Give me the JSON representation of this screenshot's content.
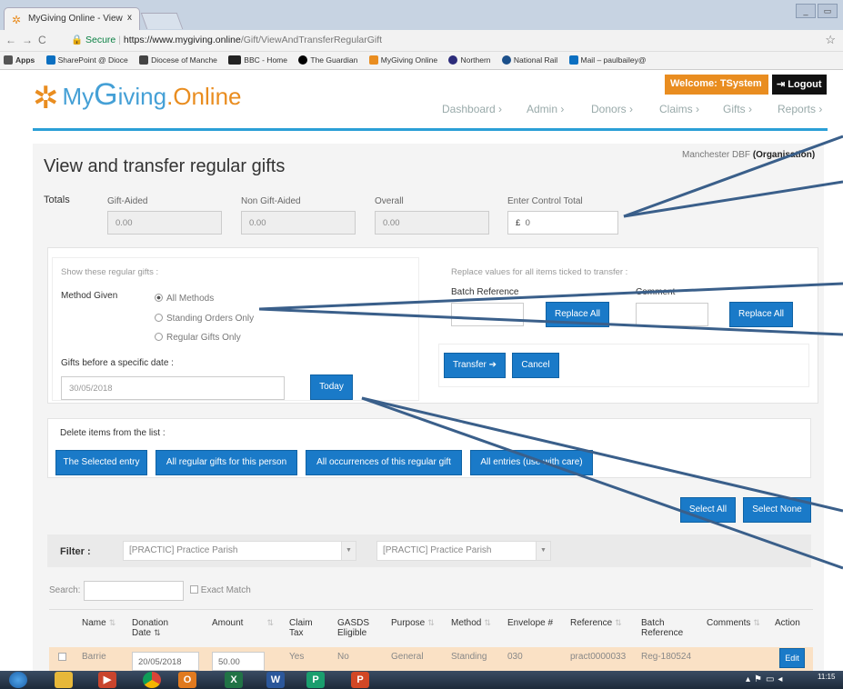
{
  "browser": {
    "tab_title": "MyGiving Online - View",
    "tab_close": "x",
    "url_secure": "Secure",
    "url_host": "https://www.mygiving.online",
    "url_path": "/Gift/ViewAndTransferRegularGift",
    "bookmarks": [
      "Apps",
      "SharePoint @ Dioce",
      "Diocese of Manche",
      "BBC - Home",
      "The Guardian",
      "MyGiving Online",
      "Northern",
      "National Rail",
      "Mail – paulbailey@"
    ]
  },
  "header": {
    "logo_my": "My",
    "logo_g": "G",
    "logo_rest": "iving",
    "logo_online": ".Online",
    "welcome": "Welcome:",
    "welcome_user": "TSystem",
    "logout": "Logout",
    "menu": [
      "Dashboard",
      "Admin",
      "Donors",
      "Claims",
      "Gifts",
      "Reports"
    ]
  },
  "page": {
    "org": "Manchester DBF",
    "org_type": "(Organisation)",
    "title": "View and transfer regular gifts",
    "totals_label": "Totals",
    "gift_aided_label": "Gift-Aided",
    "gift_aided_value": "0.00",
    "non_gift_aided_label": "Non Gift-Aided",
    "non_gift_aided_value": "0.00",
    "overall_label": "Overall",
    "overall_value": "0.00",
    "control_total_label": "Enter Control Total",
    "control_total_currency": "£",
    "control_total_value": "0"
  },
  "filters": {
    "heading": "Show these regular gifts :",
    "method_label": "Method Given",
    "methods": [
      {
        "label": "All Methods",
        "selected": true
      },
      {
        "label": "Standing Orders Only",
        "selected": false
      },
      {
        "label": "Regular Gifts Only",
        "selected": false
      }
    ],
    "date_label": "Gifts before a specific date :",
    "date_value": "30/05/2018",
    "today_button": "Today"
  },
  "replace": {
    "heading": "Replace values for all items ticked to transfer :",
    "batch_label": "Batch Reference",
    "comment_label": "Comment",
    "replace_all_1": "Replace All",
    "replace_all_2": "Replace All",
    "transfer": "Transfer",
    "cancel": "Cancel"
  },
  "delete": {
    "heading": "Delete items from the list :",
    "buttons": [
      "The Selected entry",
      "All regular gifts for this person",
      "All occurrences of this regular gift",
      "All entries (use with care)"
    ]
  },
  "selection": {
    "select_all": "Select All",
    "select_none": "Select None"
  },
  "table_filter": {
    "label": "Filter :",
    "select1": "[PRACTIC] Practice Parish",
    "select2": "[PRACTIC] Practice Parish",
    "search_label": "Search:",
    "exact_match": "Exact Match"
  },
  "table": {
    "headers": [
      "Name",
      "Donation Date",
      "Amount",
      "Claim Tax",
      "GASDS Eligible",
      "Purpose",
      "Method",
      "Envelope #",
      "Reference",
      "Batch Reference",
      "Comments",
      "Action"
    ],
    "rows": [
      {
        "name": "Barrie",
        "date": "20/05/2018",
        "amount": "50.00",
        "claim_tax": "Yes",
        "gasds": "No",
        "purpose": "General",
        "method": "Standing",
        "envelope": "030",
        "reference": "pract0000033",
        "batch": "Reg-180524",
        "comments": "",
        "action": "Edit"
      }
    ]
  },
  "taskbar": {
    "time": "11:15"
  }
}
